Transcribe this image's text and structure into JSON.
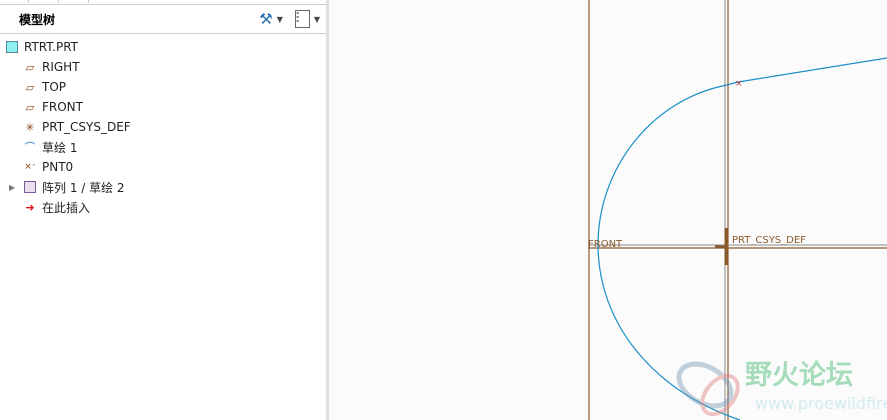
{
  "panel": {
    "title": "模型树",
    "settings_icon": "tree-settings-icon",
    "columns_icon": "tree-columns-icon"
  },
  "tree": [
    {
      "label": "RTRT.PRT",
      "icon": "part-icon",
      "indent": 0
    },
    {
      "label": "RIGHT",
      "icon": "datum-plane-icon",
      "indent": 1
    },
    {
      "label": "TOP",
      "icon": "datum-plane-icon",
      "indent": 1
    },
    {
      "label": "FRONT",
      "icon": "datum-plane-icon",
      "indent": 1
    },
    {
      "label": "PRT_CSYS_DEF",
      "icon": "csys-icon",
      "indent": 1
    },
    {
      "label": "草绘 1",
      "icon": "sketch-icon",
      "indent": 1
    },
    {
      "label": "PNT0",
      "icon": "datum-point-icon",
      "indent": 1
    },
    {
      "label": "阵列 1 / 草绘 2",
      "icon": "pattern-icon",
      "indent": 1,
      "expandable": true
    },
    {
      "label": "在此插入",
      "icon": "insert-here-icon",
      "indent": 1
    }
  ],
  "graphics": {
    "front_label": "FRONT",
    "csys_label": "PRT_CSYS_DEF",
    "datum_color": "#8b5a2b",
    "curve_color": "#1a8fc8"
  },
  "watermark": {
    "title": "野火论坛",
    "url": "www.proewildfire.cn"
  }
}
